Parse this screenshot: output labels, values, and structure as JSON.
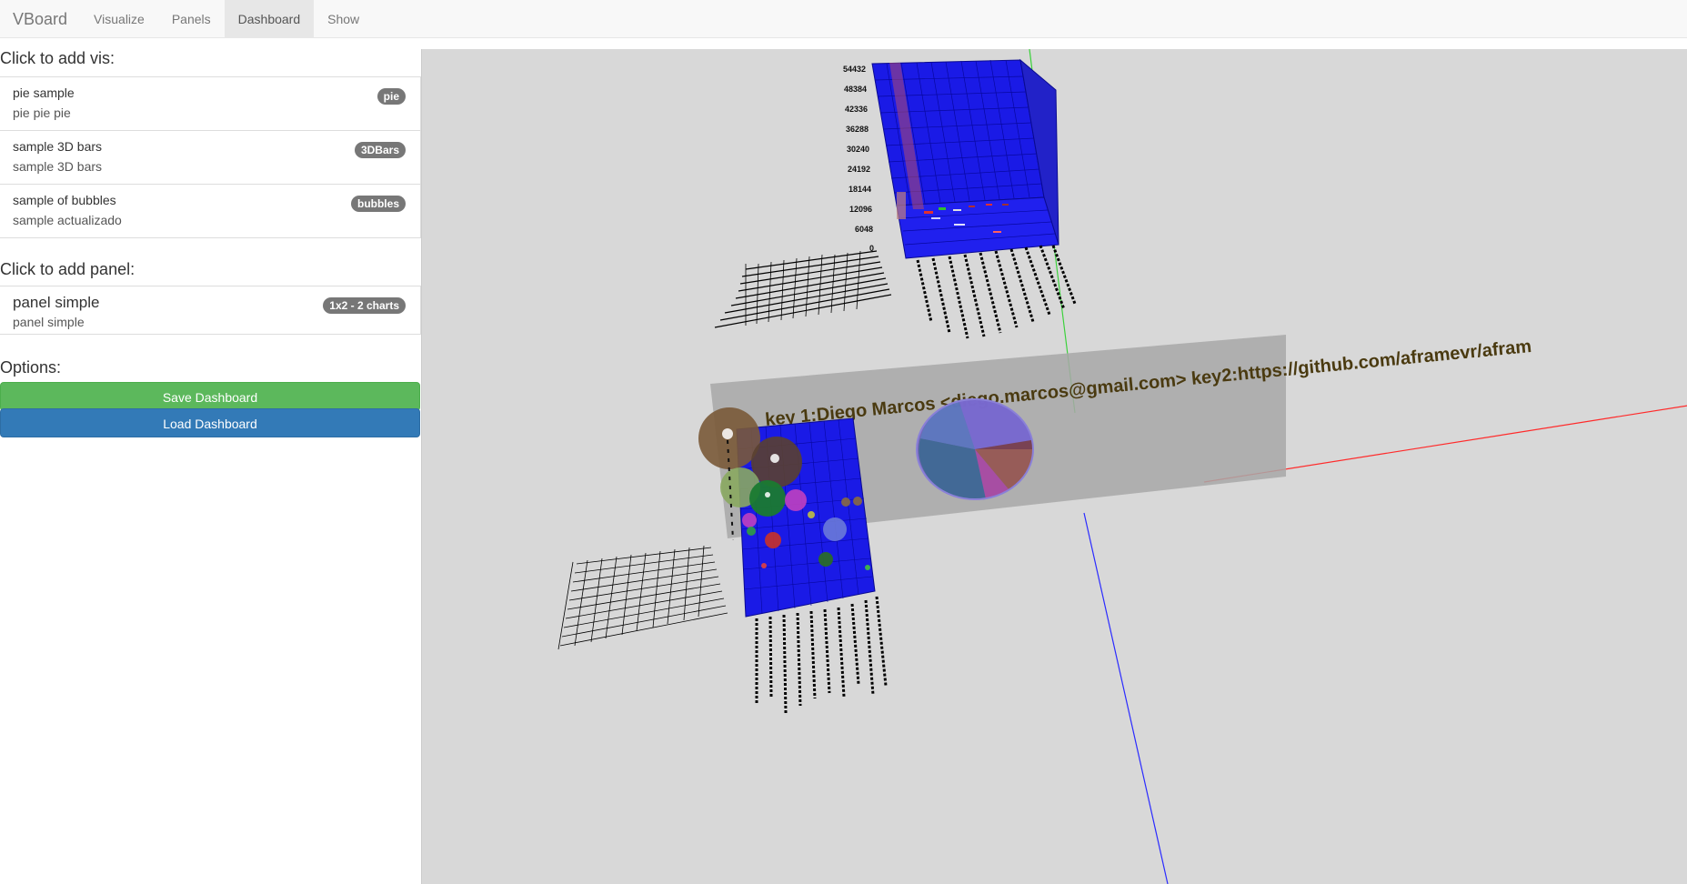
{
  "navbar": {
    "brand": "VBoard",
    "items": [
      {
        "label": "Visualize",
        "active": false
      },
      {
        "label": "Panels",
        "active": false
      },
      {
        "label": "Dashboard",
        "active": true
      },
      {
        "label": "Show",
        "active": false
      }
    ]
  },
  "sidebar": {
    "vis_title": "Click to add vis:",
    "vis_items": [
      {
        "heading": "pie sample",
        "text": "pie pie pie",
        "badge": "pie"
      },
      {
        "heading": "sample 3D bars",
        "text": "sample 3D bars",
        "badge": "3DBars"
      },
      {
        "heading": "sample of bubbles",
        "text": "sample actualizado",
        "badge": "bubbles"
      }
    ],
    "panel_title": "Click to add panel:",
    "panel_items": [
      {
        "heading": "panel simple",
        "text": "panel simple",
        "badge": "1x2 - 2 charts"
      }
    ],
    "options_title": "Options:",
    "save_label": "Save Dashboard",
    "load_label": "Load Dashboard"
  },
  "scene": {
    "bars_axis_ticks": [
      "54432",
      "48384",
      "42336",
      "36288",
      "30240",
      "24192",
      "18144",
      "12096",
      "6048",
      "0"
    ],
    "panel_text": "key 1:Diego Marcos <diego.marcos@gmail.com> key2:https://github.com/aframevr/afram",
    "colors": {
      "background": "#d8d8d8",
      "bars_grid": "#1a1ae6",
      "panel": "#a8a8a8",
      "axis_x": "#ff2a2a",
      "axis_y": "#3ad13a",
      "axis_z": "#2a2aff",
      "panel_text": "#4a3a10"
    }
  }
}
